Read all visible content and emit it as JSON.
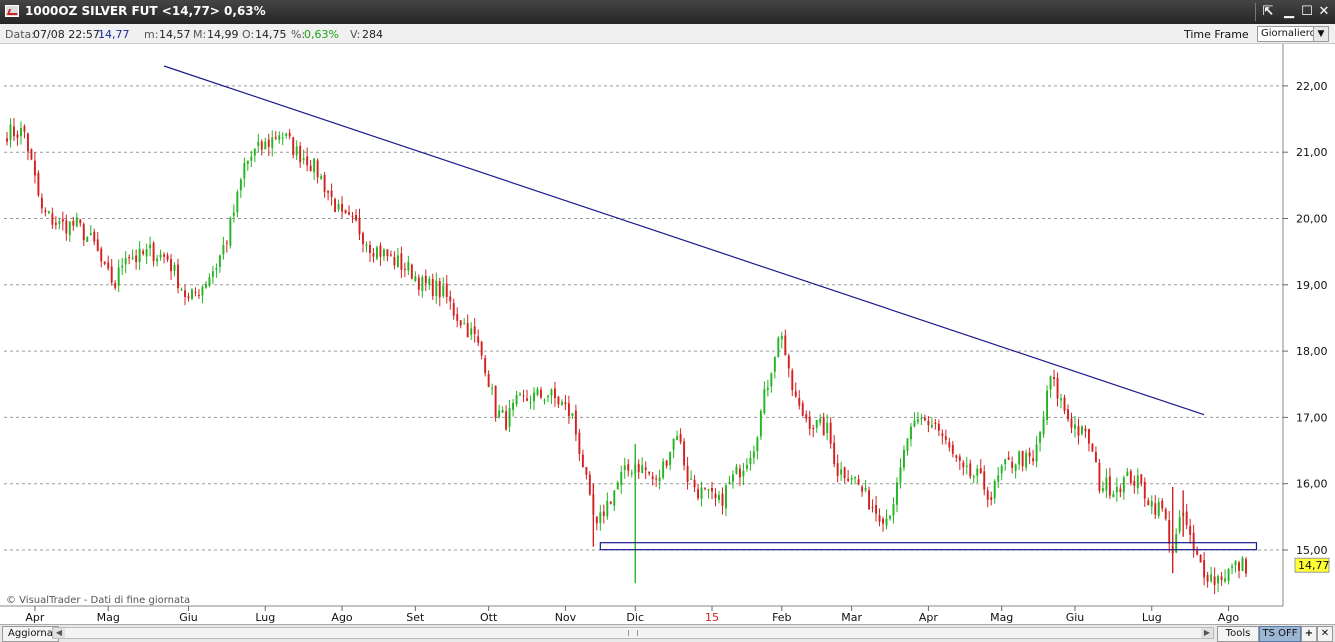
{
  "window": {
    "title": "1000OZ SILVER FUT <14,77> 0,63%",
    "controls": {
      "pin": "⇱",
      "minimize": "▁",
      "maximize": "☐",
      "close": "✕"
    }
  },
  "info": {
    "data_label": "Data:",
    "data_value": "07/08 22:57:",
    "last_value": "14,77",
    "min_label": "m:",
    "min_value": "14,57",
    "max_label": "M:",
    "max_value": "14,99",
    "open_label": "O:",
    "open_value": "14,75",
    "pct_label": "%:",
    "pct_value": "0,63%",
    "vol_label": "V:",
    "vol_value": "284",
    "timeframe_label": "Time Frame",
    "timeframe_value": "Giornaliero"
  },
  "footer": {
    "aggiorna": "Aggiorna",
    "tools": "Tools",
    "ts_off": "TS OFF",
    "plus": "+",
    "close": "✕",
    "credit": "© VisualTrader - Dati di fine giornata"
  },
  "colors": {
    "up": "#22b422",
    "down": "#d42020",
    "trendline": "#1a1a8c",
    "last_badge": "#ffff33"
  },
  "chart_data": {
    "type": "candlestick",
    "y_ticks": [
      "22,00",
      "21,00",
      "20,00",
      "19,00",
      "18,00",
      "17,00",
      "16,00",
      "15,00"
    ],
    "ylim": [
      14.2,
      22.3
    ],
    "last_price_label": "14,77",
    "x_labels": [
      {
        "label": "Apr",
        "i": 8,
        "highlight": false
      },
      {
        "label": "Mag",
        "i": 29,
        "highlight": false
      },
      {
        "label": "Giu",
        "i": 52,
        "highlight": false
      },
      {
        "label": "Lug",
        "i": 74,
        "highlight": false
      },
      {
        "label": "Ago",
        "i": 96,
        "highlight": false
      },
      {
        "label": "Set",
        "i": 117,
        "highlight": false
      },
      {
        "label": "Ott",
        "i": 138,
        "highlight": false
      },
      {
        "label": "Nov",
        "i": 160,
        "highlight": false
      },
      {
        "label": "Dic",
        "i": 180,
        "highlight": false
      },
      {
        "label": "15",
        "i": 202,
        "highlight": true
      },
      {
        "label": "Feb",
        "i": 222,
        "highlight": false
      },
      {
        "label": "Mar",
        "i": 242,
        "highlight": false
      },
      {
        "label": "Apr",
        "i": 264,
        "highlight": false
      },
      {
        "label": "Mag",
        "i": 285,
        "highlight": false
      },
      {
        "label": "Giu",
        "i": 306,
        "highlight": false
      },
      {
        "label": "Lug",
        "i": 328,
        "highlight": false
      },
      {
        "label": "Ago",
        "i": 350,
        "highlight": false
      }
    ],
    "anchors": [
      [
        0,
        21.3
      ],
      [
        5,
        21.3
      ],
      [
        10,
        20.1
      ],
      [
        15,
        19.9
      ],
      [
        20,
        19.9
      ],
      [
        25,
        19.6
      ],
      [
        28,
        19.2
      ],
      [
        31,
        19.0
      ],
      [
        34,
        19.5
      ],
      [
        37,
        19.4
      ],
      [
        41,
        19.5
      ],
      [
        46,
        19.4
      ],
      [
        52,
        18.75
      ],
      [
        56,
        19.0
      ],
      [
        60,
        19.3
      ],
      [
        63,
        19.7
      ],
      [
        66,
        20.3
      ],
      [
        68,
        20.8
      ],
      [
        71,
        21.0
      ],
      [
        74,
        21.1
      ],
      [
        78,
        21.3
      ],
      [
        80,
        21.2
      ],
      [
        83,
        21.0
      ],
      [
        86,
        20.9
      ],
      [
        89,
        20.7
      ],
      [
        92,
        20.4
      ],
      [
        96,
        20.0
      ],
      [
        100,
        19.9
      ],
      [
        104,
        19.6
      ],
      [
        110,
        19.4
      ],
      [
        113,
        19.3
      ],
      [
        116,
        19.2
      ],
      [
        119,
        19.0
      ],
      [
        123,
        18.95
      ],
      [
        126,
        18.8
      ],
      [
        128,
        18.6
      ],
      [
        131,
        18.4
      ],
      [
        134,
        18.2
      ],
      [
        137,
        17.8
      ],
      [
        140,
        17.1
      ],
      [
        143,
        16.95
      ],
      [
        146,
        17.2
      ],
      [
        150,
        17.3
      ],
      [
        155,
        17.35
      ],
      [
        159,
        17.2
      ],
      [
        162,
        17.0
      ],
      [
        165,
        16.3
      ],
      [
        167,
        15.7
      ],
      [
        169,
        15.3
      ],
      [
        171,
        15.6
      ],
      [
        173,
        15.8
      ],
      [
        176,
        16.1
      ],
      [
        180,
        16.3
      ],
      [
        183,
        16.2
      ],
      [
        186,
        16.0
      ],
      [
        189,
        16.4
      ],
      [
        192,
        16.8
      ],
      [
        195,
        16.1
      ],
      [
        198,
        15.9
      ],
      [
        201,
        15.8
      ],
      [
        204,
        15.7
      ],
      [
        207,
        16.0
      ],
      [
        211,
        16.3
      ],
      [
        214,
        16.6
      ],
      [
        217,
        17.3
      ],
      [
        220,
        18.0
      ],
      [
        222,
        18.3
      ],
      [
        224,
        17.6
      ],
      [
        227,
        17.1
      ],
      [
        231,
        16.9
      ],
      [
        235,
        16.8
      ],
      [
        238,
        16.2
      ],
      [
        242,
        16.15
      ],
      [
        246,
        15.8
      ],
      [
        249,
        15.6
      ],
      [
        252,
        15.5
      ],
      [
        255,
        15.9
      ],
      [
        258,
        16.7
      ],
      [
        262,
        16.95
      ],
      [
        266,
        16.9
      ],
      [
        270,
        16.5
      ],
      [
        274,
        16.15
      ],
      [
        278,
        16.1
      ],
      [
        282,
        15.8
      ],
      [
        285,
        16.2
      ],
      [
        290,
        16.4
      ],
      [
        294,
        16.3
      ],
      [
        297,
        17.0
      ],
      [
        299,
        17.6
      ],
      [
        301,
        17.35
      ],
      [
        304,
        17.0
      ],
      [
        307,
        16.8
      ],
      [
        310,
        16.65
      ],
      [
        313,
        16.0
      ],
      [
        317,
        15.95
      ],
      [
        322,
        16.1
      ],
      [
        325,
        15.95
      ],
      [
        328,
        15.7
      ],
      [
        331,
        15.6
      ],
      [
        334,
        15.0
      ],
      [
        337,
        15.55
      ],
      [
        340,
        14.95
      ],
      [
        343,
        14.7
      ],
      [
        346,
        14.55
      ],
      [
        349,
        14.65
      ],
      [
        352,
        14.75
      ],
      [
        354,
        14.77
      ]
    ],
    "total_bars": 356,
    "overlays": {
      "trendline": {
        "from": [
          45,
          22.3
        ],
        "to": [
          343,
          17.04
        ]
      },
      "support_box": {
        "from_i": 170,
        "to_i": 358,
        "top": 15.08,
        "bottom": 15.0
      }
    }
  }
}
